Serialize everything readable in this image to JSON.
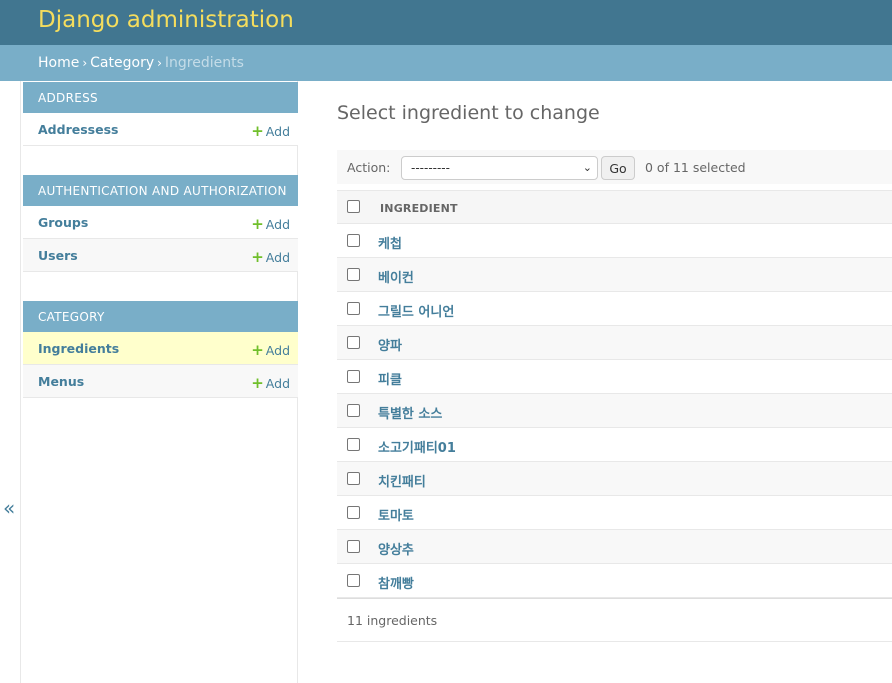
{
  "header": {
    "site_name": "Django administration"
  },
  "breadcrumbs": {
    "home": "Home",
    "category": "Category",
    "current": "Ingredients",
    "sep": "›"
  },
  "sidebar": {
    "modules": [
      {
        "caption": "ADDRESS",
        "rows": [
          {
            "label": "Addressess",
            "add": "Add"
          }
        ]
      },
      {
        "caption": "AUTHENTICATION AND AUTHORIZATION",
        "rows": [
          {
            "label": "Groups",
            "add": "Add"
          },
          {
            "label": "Users",
            "add": "Add"
          }
        ]
      },
      {
        "caption": "CATEGORY",
        "rows": [
          {
            "label": "Ingredients",
            "add": "Add"
          },
          {
            "label": "Menus",
            "add": "Add"
          }
        ]
      }
    ],
    "toggle": "«"
  },
  "content": {
    "title": "Select ingredient to change",
    "actions": {
      "label": "Action:",
      "selected_option": "---------",
      "go": "Go",
      "counter": "0 of 11 selected"
    },
    "column_header": "INGREDIENT",
    "rows": [
      "케첩",
      "베이컨",
      "그릴드 어니언",
      "양파",
      "피클",
      "특별한 소스",
      "소고기패티01",
      "치킨패티",
      "토마토",
      "양상추",
      "참깨빵"
    ],
    "paginator": "11 ingredients"
  },
  "colors": {
    "header_bg": "#417690",
    "site_name": "#f5dd5d",
    "breadcrumbs_bg": "#79aec8",
    "link": "#447e9b",
    "add_plus": "#70bf2b",
    "current_row": "#ffffcc"
  }
}
